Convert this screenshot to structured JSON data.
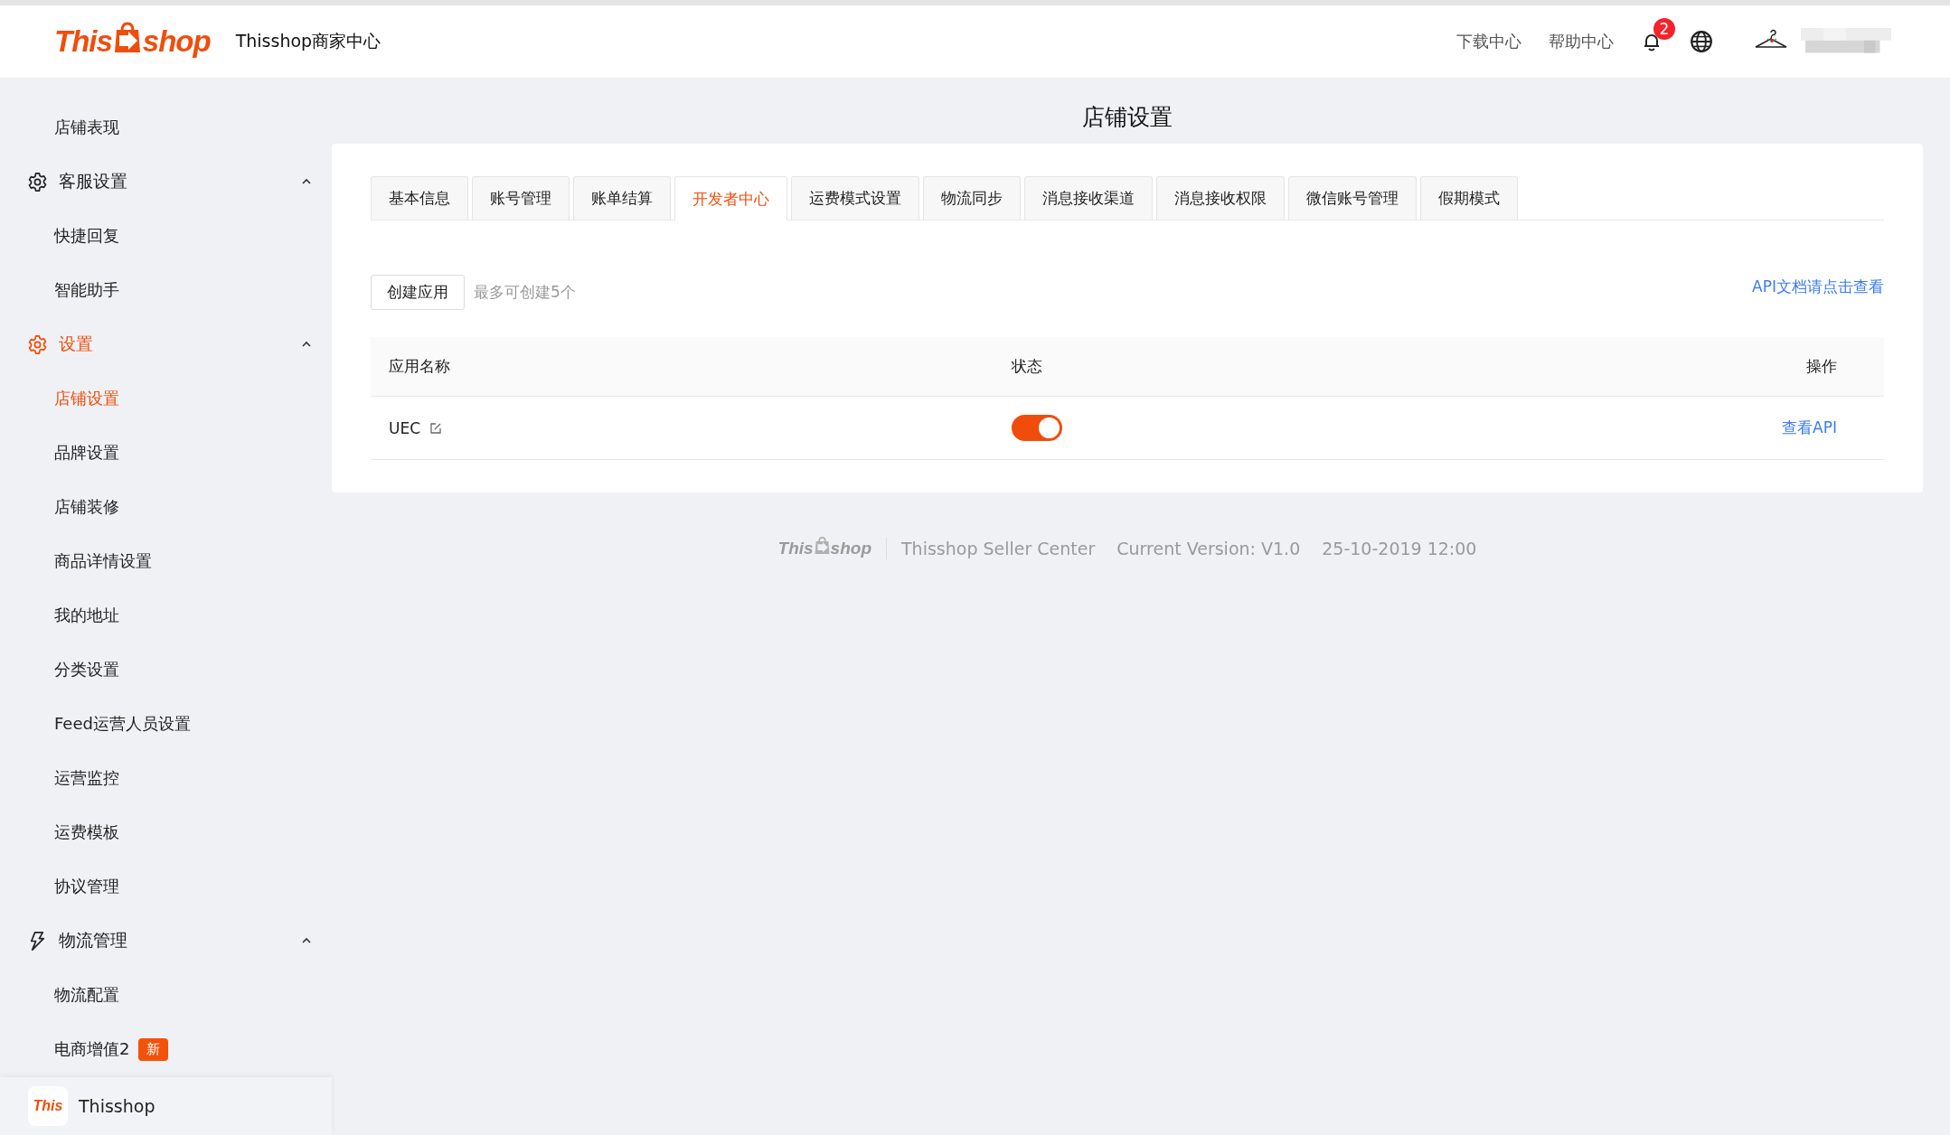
{
  "header": {
    "logo": {
      "left": "This",
      "right": "shop"
    },
    "title": "Thisshop商家中心",
    "links": [
      "下载中心",
      "帮助中心"
    ],
    "notification_count": "2"
  },
  "sidebar": {
    "items": [
      {
        "kind": "link",
        "label": "店铺表现",
        "selected": false
      },
      {
        "kind": "group",
        "label": "客服设置",
        "expanded": true,
        "selected": false,
        "children": [
          {
            "label": "快捷回复",
            "selected": false
          },
          {
            "label": "智能助手",
            "selected": false
          }
        ]
      },
      {
        "kind": "group",
        "label": "设置",
        "expanded": true,
        "selected": true,
        "children": [
          {
            "label": "店铺设置",
            "selected": true
          },
          {
            "label": "品牌设置",
            "selected": false
          },
          {
            "label": "店铺装修",
            "selected": false
          },
          {
            "label": "商品详情设置",
            "selected": false
          },
          {
            "label": "我的地址",
            "selected": false
          },
          {
            "label": "分类设置",
            "selected": false
          },
          {
            "label": "Feed运营人员设置",
            "selected": false
          },
          {
            "label": "运营监控",
            "selected": false
          },
          {
            "label": "运费模板",
            "selected": false
          },
          {
            "label": "协议管理",
            "selected": false
          }
        ]
      },
      {
        "kind": "group",
        "label": "物流管理",
        "expanded": true,
        "selected": false,
        "children": [
          {
            "label": "物流配置",
            "selected": false
          },
          {
            "label": "电商增值2",
            "selected": false,
            "badge": "新"
          }
        ]
      }
    ],
    "shop": {
      "logo": "This",
      "name": "Thisshop"
    }
  },
  "page_title": "店铺设置",
  "tabs": [
    {
      "label": "基本信息",
      "selected": false
    },
    {
      "label": "账号管理",
      "selected": false
    },
    {
      "label": "账单结算",
      "selected": false
    },
    {
      "label": "开发者中心",
      "selected": true
    },
    {
      "label": "运费模式设置",
      "selected": false
    },
    {
      "label": "物流同步",
      "selected": false
    },
    {
      "label": "消息接收渠道",
      "selected": false
    },
    {
      "label": "消息接收权限",
      "selected": false
    },
    {
      "label": "微信账号管理",
      "selected": false
    },
    {
      "label": "假期模式",
      "selected": false
    }
  ],
  "toolbar": {
    "create_button": "创建应用",
    "hint": "最多可创建5个",
    "api_docs_link": "API文档请点击查看"
  },
  "table": {
    "columns": [
      "应用名称",
      "状态",
      "操作"
    ],
    "rows": [
      {
        "name": "UEC",
        "on": true,
        "action": "查看API"
      }
    ]
  },
  "footer": {
    "logo": {
      "left": "This",
      "right": "shop"
    },
    "product": "Thisshop Seller Center",
    "version": "Current Version: V1.0",
    "date": "25-10-2019 12:00"
  }
}
